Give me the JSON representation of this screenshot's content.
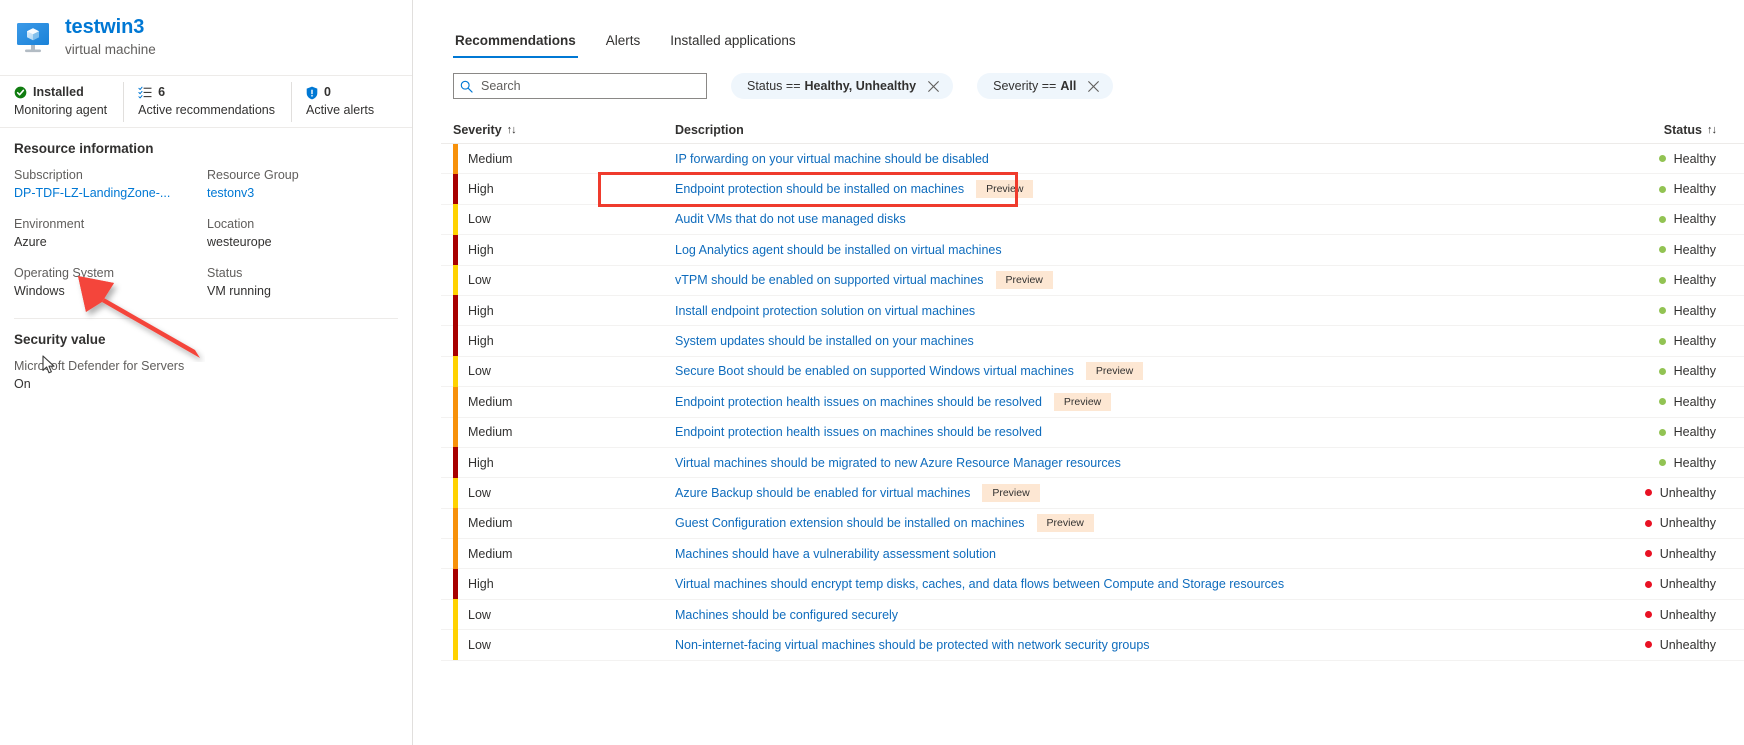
{
  "resource": {
    "icon": "virtual-machine-icon",
    "name": "testwin3",
    "type": "virtual machine"
  },
  "metrics": [
    {
      "icon": "check-circle-icon",
      "value": "Installed",
      "label": "Monitoring agent"
    },
    {
      "icon": "recommendations-list-icon",
      "value": "6",
      "label": "Active recommendations"
    },
    {
      "icon": "shield-alert-icon",
      "value": "0",
      "label": "Active alerts"
    }
  ],
  "resource_information": {
    "title": "Resource information",
    "fields": [
      {
        "label": "Subscription",
        "value": "DP-TDF-LZ-LandingZone-...",
        "link": true
      },
      {
        "label": "Resource Group",
        "value": "testonv3",
        "link": true
      },
      {
        "label": "Environment",
        "value": "Azure",
        "link": false
      },
      {
        "label": "Location",
        "value": "westeurope",
        "link": false
      },
      {
        "label": "Operating System",
        "value": "Windows",
        "link": false
      },
      {
        "label": "Status",
        "value": "VM running",
        "link": false
      }
    ]
  },
  "security_value": {
    "title": "Security value",
    "label": "Microsoft Defender for Servers",
    "value": "On"
  },
  "tabs": [
    {
      "label": "Recommendations",
      "active": true
    },
    {
      "label": "Alerts",
      "active": false
    },
    {
      "label": "Installed applications",
      "active": false
    }
  ],
  "search": {
    "placeholder": "Search",
    "value": "",
    "icon": "search-icon"
  },
  "filters": [
    {
      "prefix": "Status ==",
      "value": "Healthy, Unhealthy"
    },
    {
      "prefix": "Severity ==",
      "value": "All"
    }
  ],
  "table": {
    "columns": [
      {
        "key": "severity",
        "label": "Severity",
        "sortable": true
      },
      {
        "key": "description",
        "label": "Description",
        "sortable": false
      },
      {
        "key": "status",
        "label": "Status",
        "sortable": true
      }
    ],
    "rows": [
      {
        "severity": "Medium",
        "description": "IP forwarding on your virtual machine should be disabled",
        "preview": "",
        "status": "Healthy"
      },
      {
        "severity": "High",
        "description": "Endpoint protection should be installed on machines",
        "preview": "Preview",
        "status": "Healthy",
        "highlighted": true
      },
      {
        "severity": "Low",
        "description": "Audit VMs that do not use managed disks",
        "preview": "",
        "status": "Healthy"
      },
      {
        "severity": "High",
        "description": "Log Analytics agent should be installed on virtual machines",
        "preview": "",
        "status": "Healthy"
      },
      {
        "severity": "Low",
        "description": "vTPM should be enabled on supported virtual machines",
        "preview": "Preview",
        "status": "Healthy"
      },
      {
        "severity": "High",
        "description": "Install endpoint protection solution on virtual machines",
        "preview": "",
        "status": "Healthy"
      },
      {
        "severity": "High",
        "description": "System updates should be installed on your machines",
        "preview": "",
        "status": "Healthy"
      },
      {
        "severity": "Low",
        "description": "Secure Boot should be enabled on supported Windows virtual machines",
        "preview": "Preview",
        "status": "Healthy"
      },
      {
        "severity": "Medium",
        "description": "Endpoint protection health issues on machines should be resolved",
        "preview": "Preview",
        "status": "Healthy"
      },
      {
        "severity": "Medium",
        "description": "Endpoint protection health issues on machines should be resolved",
        "preview": "",
        "status": "Healthy"
      },
      {
        "severity": "High",
        "description": "Virtual machines should be migrated to new Azure Resource Manager resources",
        "preview": "",
        "status": "Healthy"
      },
      {
        "severity": "Low",
        "description": "Azure Backup should be enabled for virtual machines",
        "preview": "Preview",
        "status": "Unhealthy"
      },
      {
        "severity": "Medium",
        "description": "Guest Configuration extension should be installed on machines",
        "preview": "Preview",
        "status": "Unhealthy"
      },
      {
        "severity": "Medium",
        "description": "Machines should have a vulnerability assessment solution",
        "preview": "",
        "status": "Unhealthy"
      },
      {
        "severity": "High",
        "description": "Virtual machines should encrypt temp disks, caches, and data flows between Compute and Storage resources",
        "preview": "",
        "status": "Unhealthy"
      },
      {
        "severity": "Low",
        "description": "Machines should be configured securely",
        "preview": "",
        "status": "Unhealthy"
      },
      {
        "severity": "Low",
        "description": "Non-internet-facing virtual machines should be protected with network security groups",
        "preview": "",
        "status": "Unhealthy"
      }
    ]
  },
  "colors": {
    "severity_high": "#a80000",
    "severity_medium": "#f7910a",
    "severity_low": "#ffd200",
    "status_healthy": "#92c353",
    "status_unhealthy": "#e81123",
    "accent": "#0078d4",
    "link": "#0f6cbd",
    "annotation_red": "#ef3b2d",
    "preview_badge_bg": "#fde7d3",
    "chip_bg": "#eff6fc"
  },
  "annotations": {
    "arrow": "red-arrow-annotation",
    "highlight_box": "red-highlight-box-annotation",
    "cursor": "mouse-cursor"
  }
}
